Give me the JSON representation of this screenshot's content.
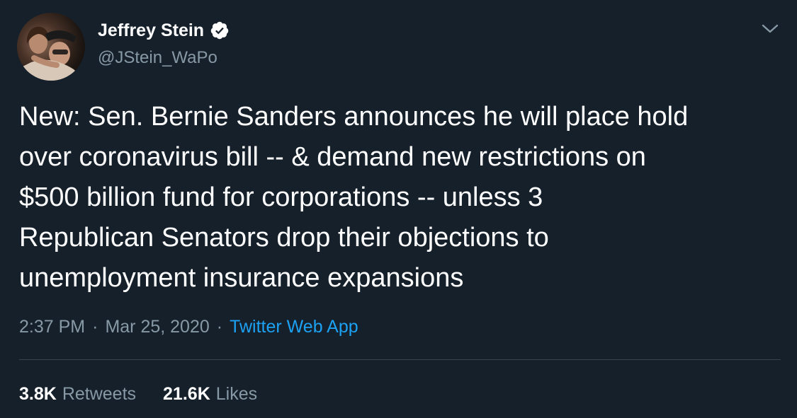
{
  "tweet": {
    "author": {
      "display_name": "Jeffrey Stein",
      "handle": "@JStein_WaPo",
      "verified": true,
      "avatar_icon": "profile-photo"
    },
    "text": "New: Sen. Bernie Sanders announces he will place hold\nover coronavirus bill -- & demand new restrictions on\n$500 billion fund for corporations -- unless 3\nRepublican Senators drop their objections to\nunemployment insurance expansions",
    "time": "2:37 PM",
    "date": "Mar 25, 2020",
    "separator": "·",
    "source": "Twitter Web App",
    "stats": {
      "retweets_count": "3.8K",
      "retweets_label": "Retweets",
      "likes_count": "21.6K",
      "likes_label": "Likes"
    },
    "menu_icon": "chevron-down-icon"
  },
  "colors": {
    "background": "#15202b",
    "text_primary": "#ffffff",
    "text_secondary": "#8899a6",
    "link": "#1da1f2",
    "divider": "#38444d"
  }
}
